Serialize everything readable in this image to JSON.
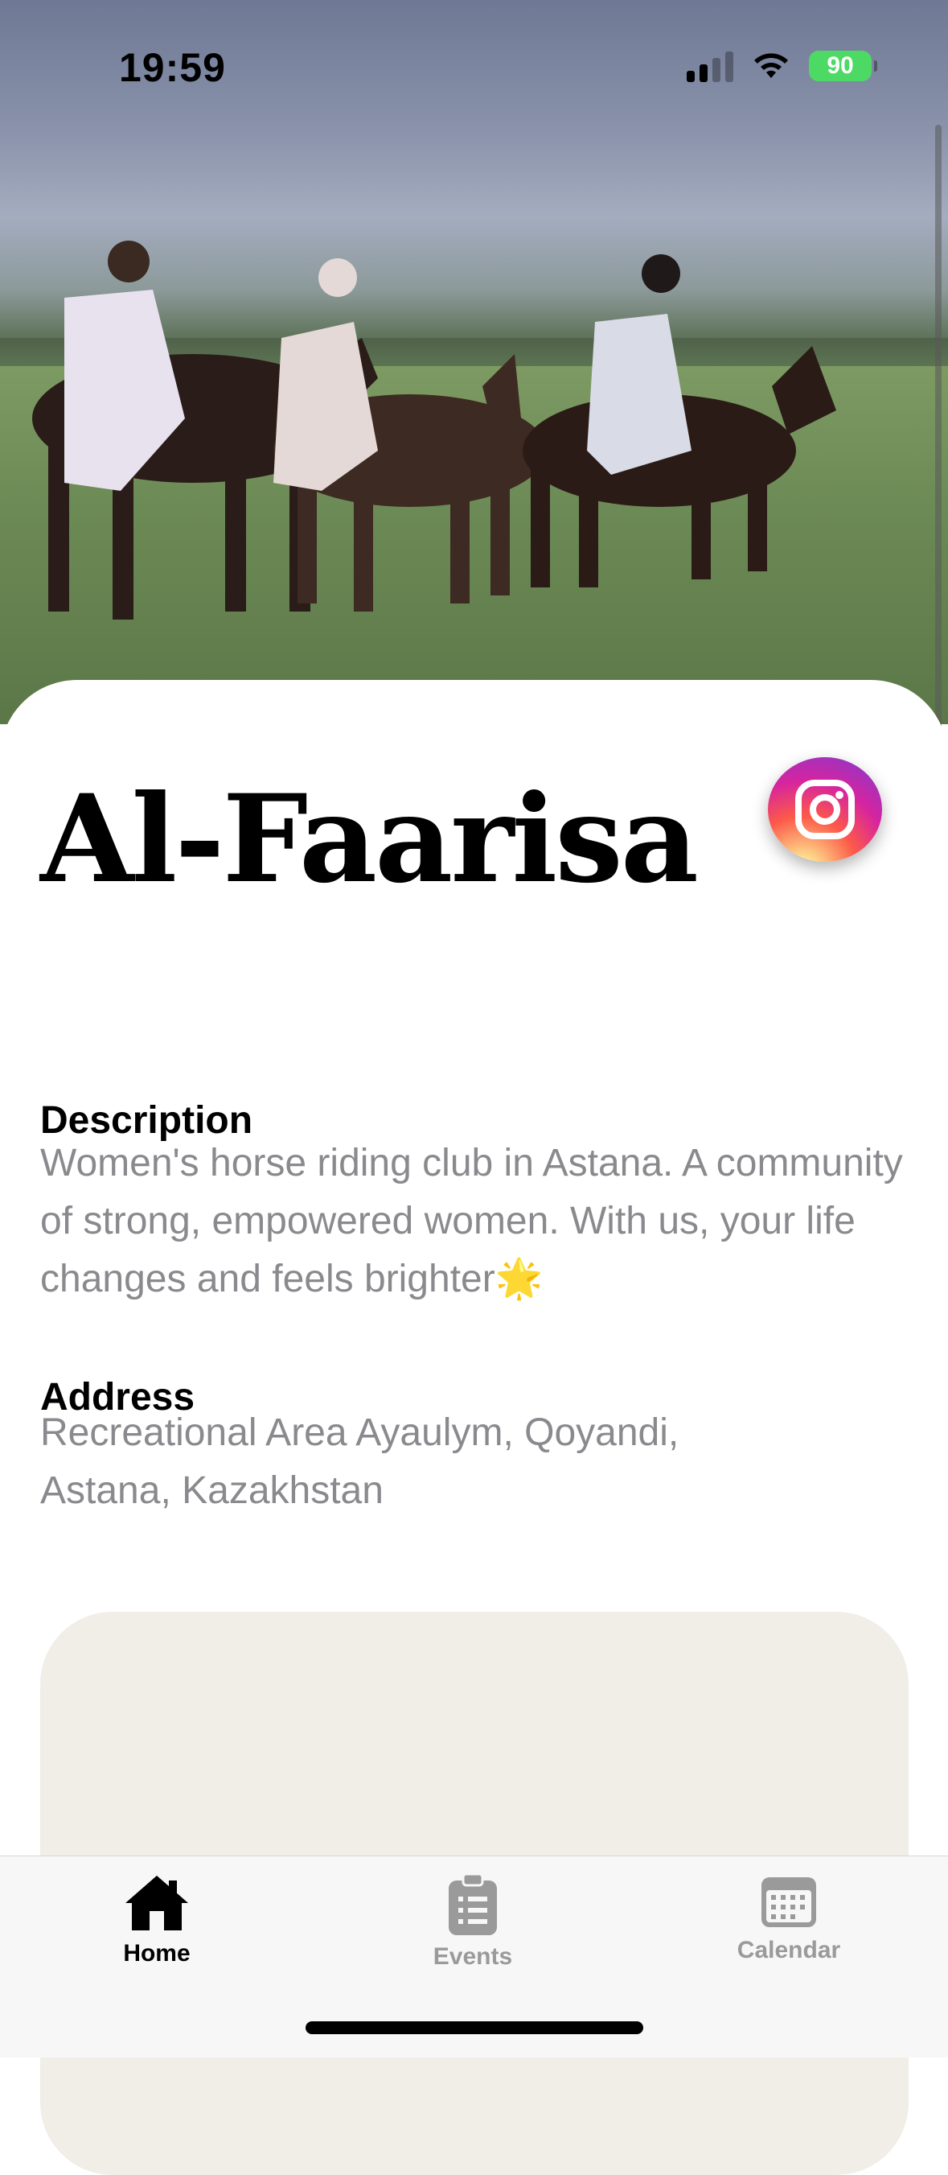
{
  "status_bar": {
    "time": "19:59",
    "battery": "90"
  },
  "club": {
    "name": "Al-Faarisa"
  },
  "description": {
    "label": "Description",
    "text": "Women's horse riding club in Astana. A community of strong, empowered women. With us, your life changes and feels brighter🌟"
  },
  "address": {
    "label": "Address",
    "text": "Recreational Area Ayaulym, Qoyandi, Astana, Kazakhstan"
  },
  "tabs": [
    {
      "label": "Home",
      "icon": "home-icon",
      "active": true
    },
    {
      "label": "Events",
      "icon": "clipboard-list-icon",
      "active": false
    },
    {
      "label": "Calendar",
      "icon": "calendar-icon",
      "active": false
    }
  ],
  "colors": {
    "inactive_tab": "#9a9a9a",
    "map_placeholder": "#f1eee8",
    "body_text": "#8a8a8e"
  }
}
